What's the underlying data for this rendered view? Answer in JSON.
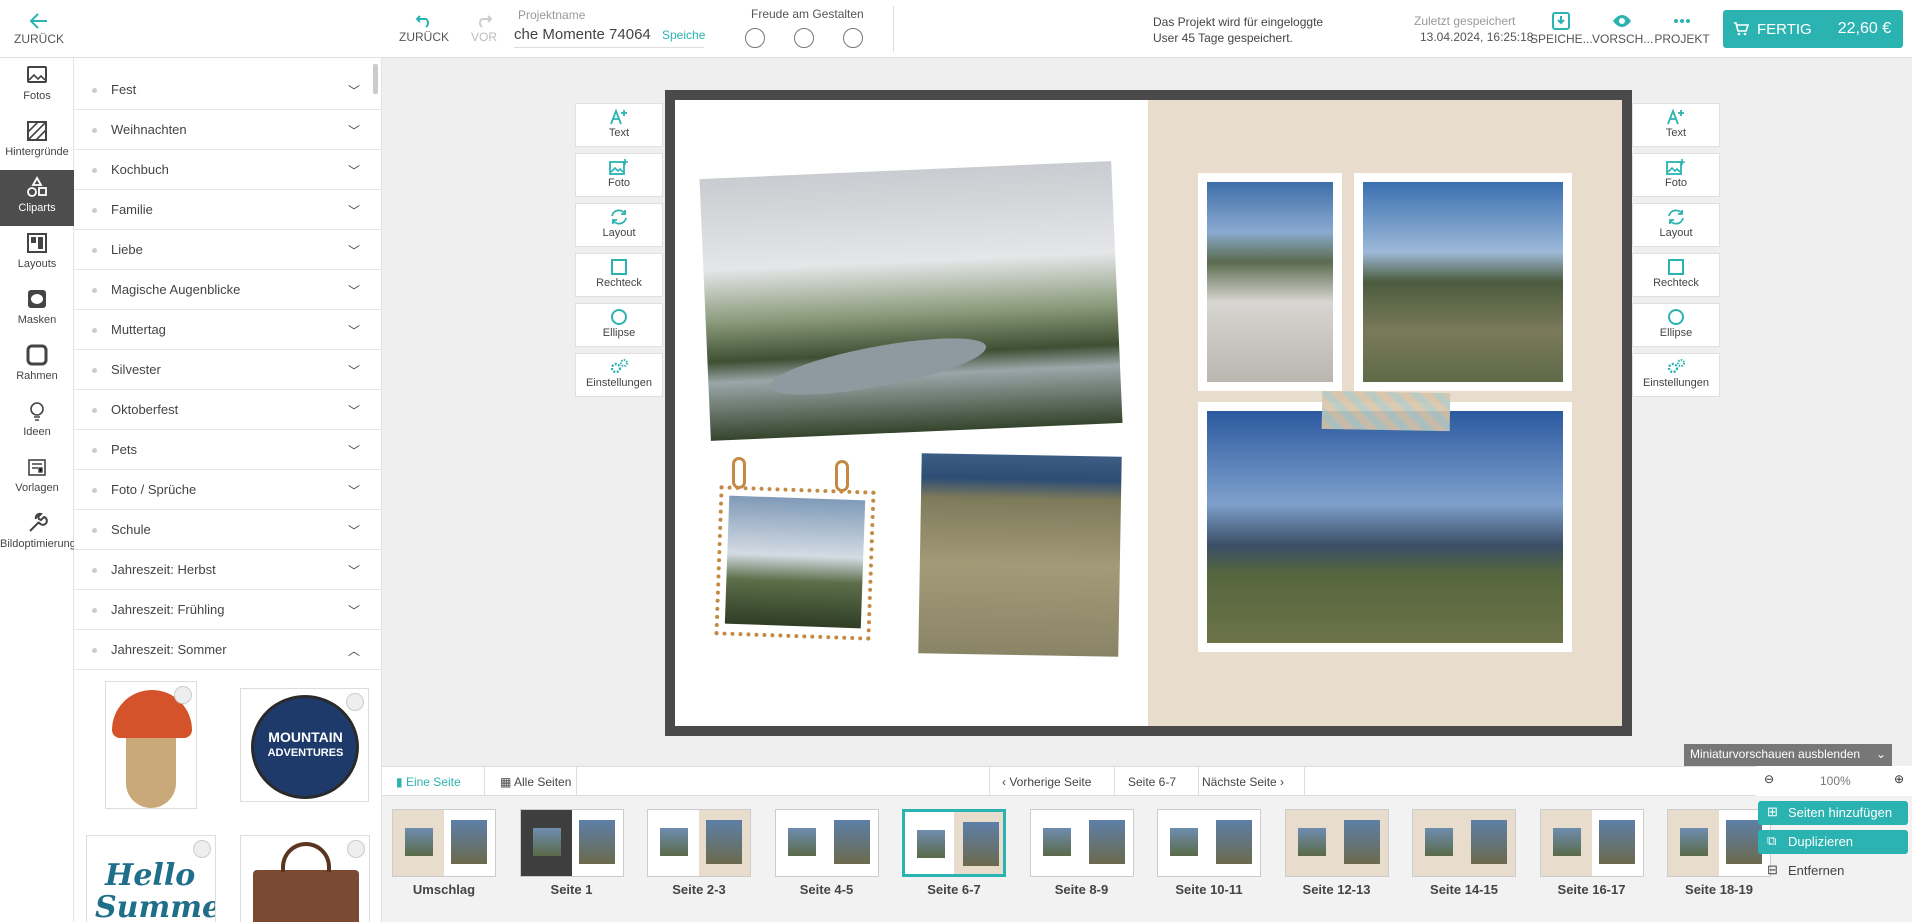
{
  "topbar": {
    "back_label": "ZURÜCK",
    "undo_label": "ZURÜCK",
    "redo_label": "VOR",
    "project_name_label": "Projektname",
    "project_name_value": "che Momente 74064",
    "save_inline_label": "Speiche",
    "joy_label": "Freude am Gestalten",
    "info_text": "Das Projekt wird für eingeloggte User 45 Tage gespeichert.",
    "last_saved_label": "Zuletzt gespeichert",
    "last_saved_date": "13.04.2024, 16:25:18",
    "save_label": "SPEICHE...",
    "preview_label": "VORSCH...",
    "project_label": "PROJEKT",
    "done_label": "FERTIG",
    "price": "22,60 €",
    "accent_color": "#2bb3b1"
  },
  "leftnav": {
    "items": [
      {
        "label": "Fotos",
        "icon": "photo-icon"
      },
      {
        "label": "Hintergründe",
        "icon": "background-icon"
      },
      {
        "label": "Cliparts",
        "icon": "shapes-icon"
      },
      {
        "label": "Layouts",
        "icon": "layout-icon"
      },
      {
        "label": "Masken",
        "icon": "mask-icon"
      },
      {
        "label": "Rahmen",
        "icon": "frame-icon"
      },
      {
        "label": "Ideen",
        "icon": "lightbulb-icon"
      },
      {
        "label": "Vorlagen",
        "icon": "template-icon"
      },
      {
        "label": "Bildoptimierung",
        "icon": "wrench-icon"
      }
    ]
  },
  "categories": [
    "Fest",
    "Weihnachten",
    "Kochbuch",
    "Familie",
    "Liebe",
    "Magische Augenblicke",
    "Muttertag",
    "Silvester",
    "Oktoberfest",
    "Pets",
    "Foto / Sprüche",
    "Schule",
    "Jahreszeit: Herbst",
    "Jahreszeit: Frühling",
    "Jahreszeit: Sommer"
  ],
  "cliparts": {
    "badge_text_1": "MOUNTAIN",
    "badge_text_2": "ADVENTURES",
    "hello_text_1": "Hello",
    "hello_text_2": "Summer"
  },
  "tools": [
    {
      "label": "Text",
      "icon": "add-text-icon"
    },
    {
      "label": "Foto",
      "icon": "add-photo-icon"
    },
    {
      "label": "Layout",
      "icon": "layout-refresh-icon"
    },
    {
      "label": "Rechteck",
      "icon": "rectangle-icon"
    },
    {
      "label": "Ellipse",
      "icon": "ellipse-icon"
    },
    {
      "label": "Einstellungen",
      "icon": "settings-icon"
    }
  ],
  "bottombar": {
    "single_page": "Eine Seite",
    "all_pages": "Alle Seiten",
    "prev_page": "Vorherige Seite",
    "current_page": "Seite 6-7",
    "next_page": "Nächste Seite",
    "hide_previews": "Miniaturvorschauen ausblenden",
    "zoom": "100%"
  },
  "thumbnails": [
    "Umschlag",
    "Seite 1",
    "Seite 2-3",
    "Seite 4-5",
    "Seite 6-7",
    "Seite 8-9",
    "Seite 10-11",
    "Seite 12-13",
    "Seite 14-15",
    "Seite 16-17",
    "Seite 18-19"
  ],
  "page_menu": {
    "add_pages": "Seiten hinzufügen",
    "duplicate": "Duplizieren",
    "remove": "Entfernen"
  }
}
